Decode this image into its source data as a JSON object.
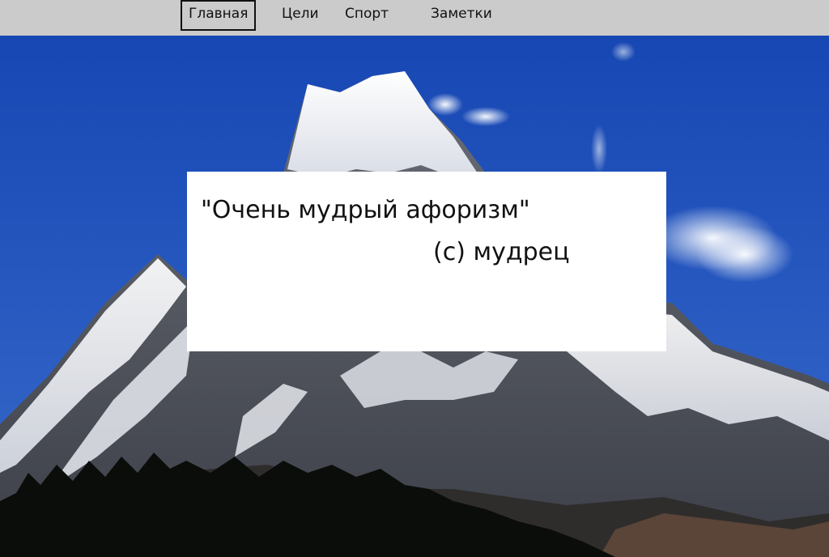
{
  "nav": {
    "items": [
      {
        "label": "Главная",
        "active": true
      },
      {
        "label": "Цели",
        "active": false
      },
      {
        "label": "Спорт",
        "active": false
      },
      {
        "label": "Заметки",
        "active": false
      }
    ]
  },
  "quote": {
    "text": "\"Очень мудрый афоризм\"",
    "author": "(с) мудрец"
  },
  "colors": {
    "nav_background": "#cbcbcb",
    "sky": "#1f4fb5",
    "card_background": "#ffffff",
    "text": "#111111"
  },
  "background": {
    "subject": "snow-capped-mountain-photo"
  }
}
